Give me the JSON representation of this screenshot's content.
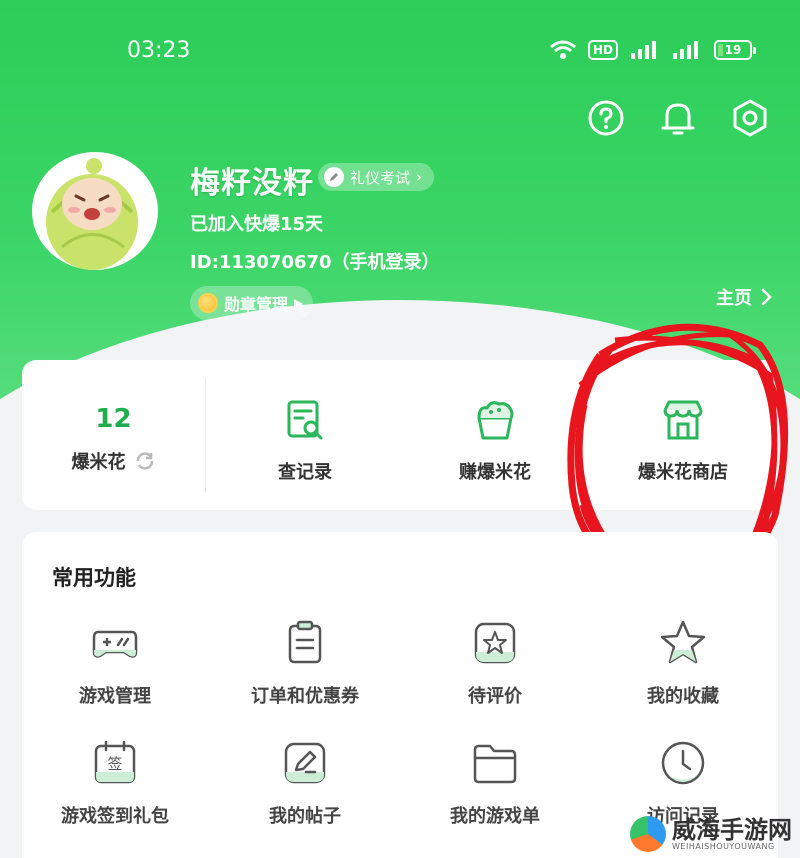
{
  "status_bar": {
    "time": "03:23",
    "network_badge": "HD",
    "battery": "19"
  },
  "top_icons": [
    "help-icon",
    "bell-icon",
    "settings-icon"
  ],
  "profile": {
    "username": "梅籽没籽",
    "etiquette_badge": "礼仪考试",
    "joined": "已加入快爆15天",
    "id_line": "ID:113070670（手机登录）",
    "medal_button": "勋章管理",
    "homepage_link": "主页"
  },
  "popcorn": {
    "count": "12",
    "label": "爆米花"
  },
  "quick_actions": [
    {
      "label": "查记录",
      "icon": "record-search-icon"
    },
    {
      "label": "赚爆米花",
      "icon": "popcorn-bucket-icon"
    },
    {
      "label": "爆米花商店",
      "icon": "store-icon"
    }
  ],
  "common": {
    "title": "常用功能",
    "items": [
      {
        "label": "游戏管理",
        "icon": "gamepad-icon"
      },
      {
        "label": "订单和优惠券",
        "icon": "clipboard-icon"
      },
      {
        "label": "待评价",
        "icon": "review-star-icon"
      },
      {
        "label": "我的收藏",
        "icon": "star-icon"
      },
      {
        "label": "游戏签到礼包",
        "icon": "checkin-calendar-icon"
      },
      {
        "label": "我的帖子",
        "icon": "edit-post-icon"
      },
      {
        "label": "我的游戏单",
        "icon": "folder-icon"
      },
      {
        "label": "访问记录",
        "icon": "clock-icon"
      }
    ]
  },
  "watermark": {
    "title": "威海手游网",
    "subtitle": "WEIHAISHOUYOUWANG"
  },
  "colors": {
    "brand_green": "#2ccd58",
    "accent_green": "#1fae4e",
    "annotation_red": "#e8141e"
  }
}
